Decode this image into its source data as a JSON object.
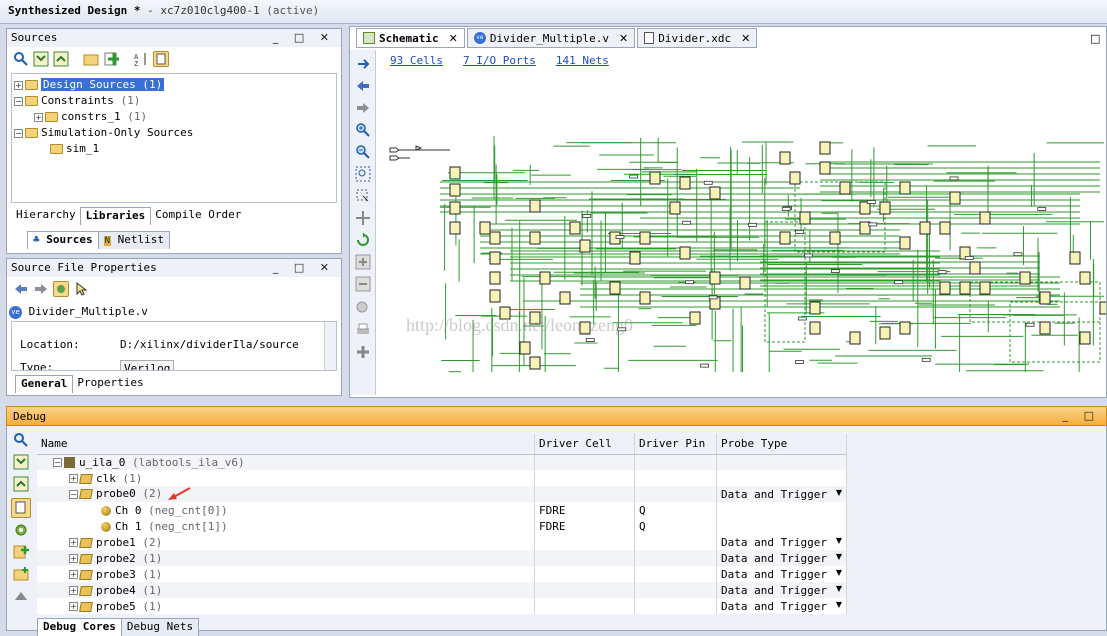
{
  "titlebar": {
    "title": "Synthesized Design *",
    "sep": " - ",
    "part": "xc7z010clg400-1",
    "status": "(active)"
  },
  "sources": {
    "header": "Sources",
    "tree": [
      {
        "label": "Design Sources",
        "count": "(1)"
      },
      {
        "label": "Constraints",
        "count": "(1)"
      },
      {
        "label": "constrs_1",
        "count": "(1)"
      },
      {
        "label": "Simulation-Only Sources",
        "count": ""
      },
      {
        "label": "sim_1",
        "count": ""
      }
    ],
    "view_tabs": [
      "Hierarchy",
      "Libraries",
      "Compile Order"
    ],
    "bottom_tabs": [
      "Sources",
      "Netlist"
    ]
  },
  "props": {
    "header": "Source File Properties",
    "filename": "Divider_Multiple.v",
    "location_label": "Location:",
    "location_value": "D:/xilinx/dividerIla/source",
    "type_label": "Type:",
    "type_value": "Verilog",
    "tabs": [
      "General",
      "Properties"
    ]
  },
  "editor": {
    "tabs": [
      "Schematic",
      "Divider_Multiple.v",
      "Divider.xdc"
    ],
    "stats": [
      "93 Cells",
      "7 I/O Ports",
      "141 Nets"
    ],
    "watermark": "http://blog.csdn.net/leon_zeng0"
  },
  "debug": {
    "header": "Debug",
    "columns": [
      "Name",
      "Driver Cell",
      "Driver Pin",
      "Probe Type"
    ],
    "rows": [
      {
        "name": "u_ila_0",
        "count": "(labtools_ila_v6)",
        "cell": "",
        "pin": "",
        "ptype": ""
      },
      {
        "name": "clk",
        "count": "(1)",
        "cell": "",
        "pin": "",
        "ptype": ""
      },
      {
        "name": "probe0",
        "count": "(2)",
        "cell": "",
        "pin": "",
        "ptype": "Data and Trigger"
      },
      {
        "name": "Ch 0",
        "count": "(neg_cnt[0])",
        "cell": "FDRE",
        "pin": "Q",
        "ptype": ""
      },
      {
        "name": "Ch 1",
        "count": "(neg_cnt[1])",
        "cell": "FDRE",
        "pin": "Q",
        "ptype": ""
      },
      {
        "name": "probe1",
        "count": "(2)",
        "cell": "",
        "pin": "",
        "ptype": "Data and Trigger"
      },
      {
        "name": "probe2",
        "count": "(1)",
        "cell": "",
        "pin": "",
        "ptype": "Data and Trigger"
      },
      {
        "name": "probe3",
        "count": "(1)",
        "cell": "",
        "pin": "",
        "ptype": "Data and Trigger"
      },
      {
        "name": "probe4",
        "count": "(1)",
        "cell": "",
        "pin": "",
        "ptype": "Data and Trigger"
      },
      {
        "name": "probe5",
        "count": "(1)",
        "cell": "",
        "pin": "",
        "ptype": "Data and Trigger"
      }
    ],
    "bottom_tabs": [
      "Debug Cores",
      "Debug Nets"
    ]
  }
}
